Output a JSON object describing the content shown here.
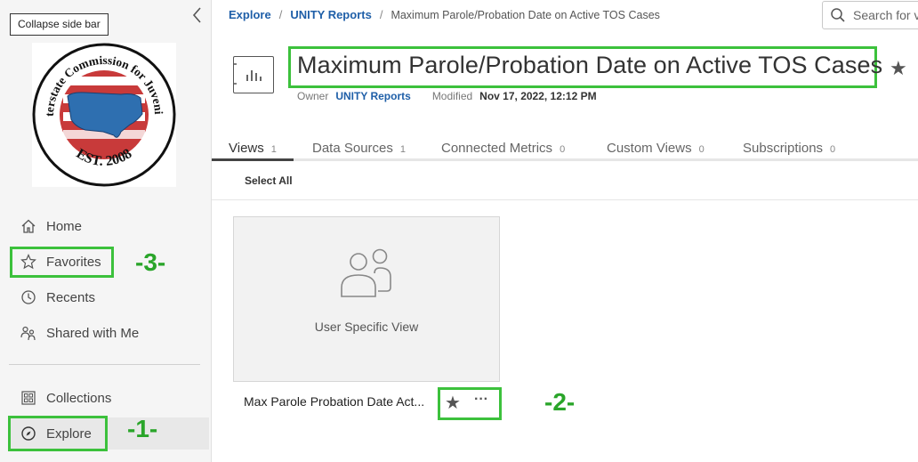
{
  "sidebar": {
    "tooltip": "Collapse side bar",
    "logo_text": {
      "top": "Interstate Commission for Juveniles",
      "bottom": "EST. 2008"
    },
    "items": [
      {
        "label": "Home",
        "icon": "home-icon"
      },
      {
        "label": "Favorites",
        "icon": "star-outline-icon"
      },
      {
        "label": "Recents",
        "icon": "clock-icon"
      },
      {
        "label": "Shared with Me",
        "icon": "shared-users-icon"
      },
      {
        "label": "Collections",
        "icon": "grid-icon"
      },
      {
        "label": "Explore",
        "icon": "compass-icon"
      }
    ]
  },
  "breadcrumb": {
    "items": [
      "Explore",
      "UNITY Reports"
    ],
    "current": "Maximum Parole/Probation Date on Active TOS Cases",
    "separator": "/"
  },
  "search": {
    "placeholder": "Search for v"
  },
  "workbook": {
    "title": "Maximum Parole/Probation Date on Active TOS Cases",
    "owner_label": "Owner",
    "owner": "UNITY Reports",
    "modified_label": "Modified",
    "modified": "Nov 17, 2022, 12:12 PM"
  },
  "tabs": [
    {
      "label": "Views",
      "count": "1"
    },
    {
      "label": "Data Sources",
      "count": "1"
    },
    {
      "label": "Connected Metrics",
      "count": "0"
    },
    {
      "label": "Custom Views",
      "count": "0"
    },
    {
      "label": "Subscriptions",
      "count": "0"
    }
  ],
  "toolbar": {
    "select_all": "Select All"
  },
  "view_card": {
    "thumbnail_label": "User Specific View",
    "title": "Max Parole Probation Date Act...",
    "more": "···"
  },
  "annotations": {
    "one": "-1-",
    "two": "-2-",
    "three": "-3-"
  },
  "colors": {
    "highlight": "#3cc13c",
    "annotation": "#2aa52a",
    "link": "#1f5fa8"
  }
}
